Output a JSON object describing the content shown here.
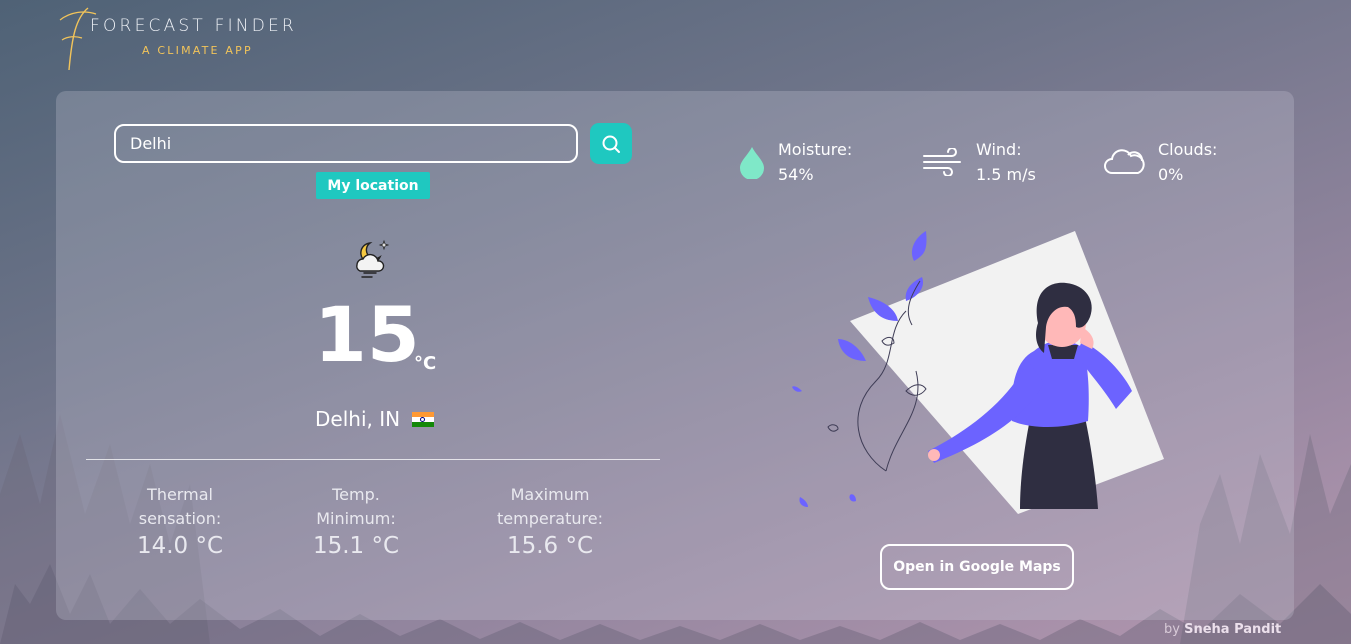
{
  "brand": {
    "title": "FORECAST FINDER",
    "subtitle": "A CLIMATE APP",
    "accent": "#f2c45a"
  },
  "search": {
    "value": "Delhi",
    "placeholder": "",
    "button_icon": "search-icon"
  },
  "location_button": "My location",
  "current": {
    "icon": "moon-cloud-wind-icon",
    "temperature": "15",
    "unit": "°C",
    "city": "Delhi, IN",
    "flag": "india-flag-icon"
  },
  "stats": [
    {
      "label_line1": "Thermal",
      "label_line2": "sensation:",
      "value": "14.0 °C"
    },
    {
      "label_line1": "Temp.",
      "label_line2": "Minimum:",
      "value": "15.1 °C"
    },
    {
      "label_line1": "Maximum",
      "label_line2": "temperature:",
      "value": "15.6 °C"
    }
  ],
  "metrics": [
    {
      "label": "Moisture:",
      "value": "54%",
      "icon": "water-drop-icon"
    },
    {
      "label": "Wind:",
      "value": "1.5 m/s",
      "icon": "wind-icon"
    },
    {
      "label": "Clouds:",
      "value": "0%",
      "icon": "cloud-icon"
    }
  ],
  "maps_button": "Open in Google Maps",
  "credit": {
    "prefix": "by",
    "author": "Sneha Pandit"
  },
  "colors": {
    "teal": "#1fc8c0",
    "purple": "#6c63ff",
    "drop": "#7fe8c8"
  }
}
